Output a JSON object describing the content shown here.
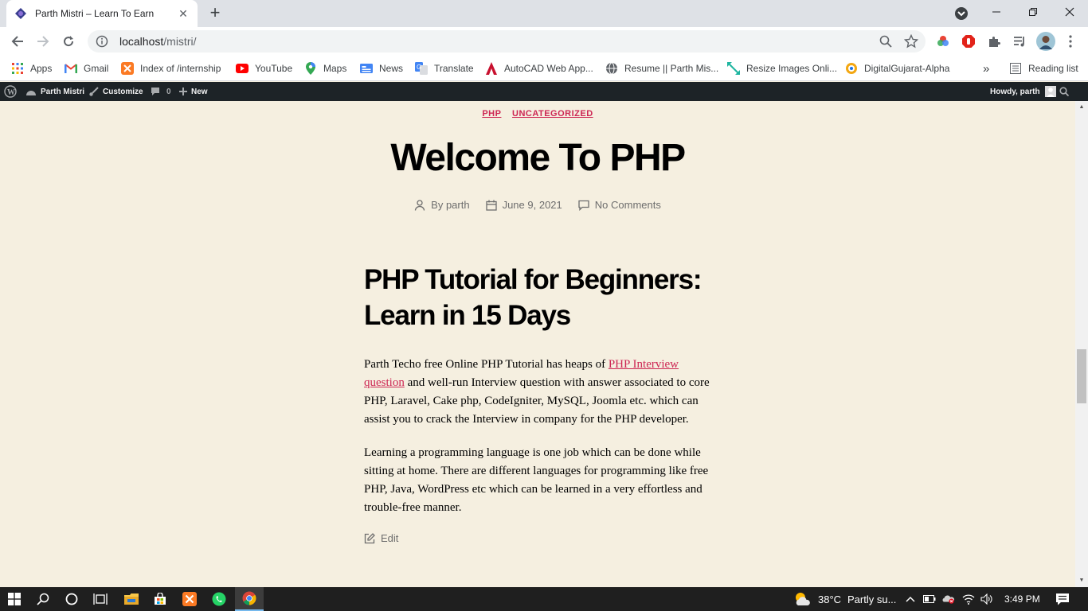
{
  "browser": {
    "tab_title": "Parth Mistri – Learn To Earn",
    "url_host": "localhost",
    "url_path": "/mistri/"
  },
  "bookmarks": {
    "items": [
      {
        "label": "Apps",
        "icon": "apps-grid-icon"
      },
      {
        "label": "Gmail",
        "icon": "gmail-icon"
      },
      {
        "label": "Index of /internship",
        "icon": "xampp-icon"
      },
      {
        "label": "YouTube",
        "icon": "youtube-icon"
      },
      {
        "label": "Maps",
        "icon": "maps-icon"
      },
      {
        "label": "News",
        "icon": "news-icon"
      },
      {
        "label": "Translate",
        "icon": "translate-icon"
      },
      {
        "label": "AutoCAD Web App...",
        "icon": "autocad-icon"
      },
      {
        "label": "Resume || Parth Mis...",
        "icon": "globe-icon"
      },
      {
        "label": "Resize Images Onli...",
        "icon": "resize-icon"
      },
      {
        "label": "DigitalGujarat-Alpha",
        "icon": "digitalgujarat-icon"
      }
    ],
    "overflow": "»",
    "reading_list": "Reading list"
  },
  "adminbar": {
    "site_name": "Parth Mistri",
    "customize": "Customize",
    "comments_count": "0",
    "new": "New",
    "howdy": "Howdy, parth"
  },
  "post": {
    "categories": [
      "PHP",
      "UNCATEGORIZED"
    ],
    "title": "Welcome To PHP",
    "author": "By parth",
    "date": "June 9, 2021",
    "comments": "No Comments",
    "heading": "PHP Tutorial for Beginners: Learn in 15 Days",
    "p1_before": "Parth Techo free Online PHP Tutorial has heaps of ",
    "p1_link": "PHP Interview question",
    "p1_after": " and well-run Interview question with answer associated to core PHP, Laravel, Cake php, CodeIgniter, MySQL, Joomla etc. which can assist you to crack the Interview in company for the PHP developer.",
    "p2": "Learning a programming language is one job which can be done while sitting at home. There are different languages for programming like free PHP, Java, WordPress  etc which can be learned in a very effortless and trouble-free manner.",
    "edit": "Edit"
  },
  "taskbar": {
    "weather": "38°C",
    "weather_desc": "Partly su...",
    "time": "3:49 PM"
  },
  "colors": {
    "accent": "#cd2653",
    "page_bg": "#f5efe0",
    "adminbar_bg": "#1d2327",
    "taskbar_bg": "#1f1f1f"
  }
}
